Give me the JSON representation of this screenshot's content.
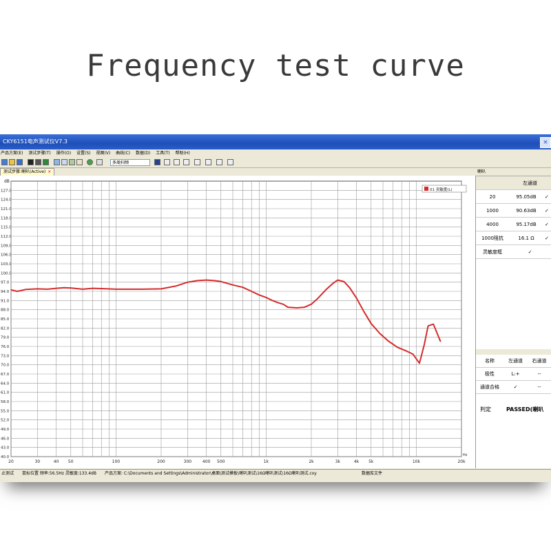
{
  "heading": "Frequency test curve",
  "window": {
    "title": "CKY6151电声测试仪V7.3",
    "close_icon": "close-icon"
  },
  "menu": [
    "产品方案(E)",
    "测试步骤(T)",
    "操作(O)",
    "设置(S)",
    "视图(V)",
    "曲线(C)",
    "数据(D)",
    "工具(T)",
    "帮助(H)"
  ],
  "toolbar": {
    "combo_value": "多周扫频"
  },
  "tab": {
    "label": "测试步骤:喇叭(Active)",
    "close": "×"
  },
  "right_panel": {
    "title": "喇叭",
    "column_header": "左通道",
    "rows": [
      {
        "name": "20",
        "value": "95.05dB",
        "status": "✓"
      },
      {
        "name": "1000",
        "value": "90.63dB",
        "status": "✓"
      },
      {
        "name": "4000",
        "value": "95.17dB",
        "status": "✓"
      },
      {
        "name": "1000阻抗",
        "value": "16.1 Ω",
        "status": "✓"
      },
      {
        "name": "灵敏度框",
        "value": "",
        "status": "✓"
      }
    ],
    "summary_headers": [
      "名称",
      "左通道",
      "右通道"
    ],
    "summary_rows": [
      [
        "极性",
        "L:+",
        "--"
      ],
      [
        "通道合格",
        "✓",
        "--"
      ]
    ],
    "verdict_label": "判定",
    "verdict_value": "PASSED(喇叭"
  },
  "status_bar": {
    "left": "止测试",
    "cursor": "鼠标位置 频率:56.5Hz 灵敏度:133.4dB",
    "scheme": "产品方案: C:\\Documents and Settings\\Administrator\\桌面\\测试模板\\喇叭测试\\16Ω喇叭测试\\16Ω喇叭测试.cxy",
    "db": "数据库文件"
  },
  "chart_data": {
    "type": "line",
    "x_scale": "log",
    "xlim": [
      20,
      20000
    ],
    "ylim": [
      40,
      130
    ],
    "ylabel": "dB",
    "xlabel_unit": "Hz",
    "y_ticks": [
      "127.0",
      "124.0",
      "121.0",
      "118.0",
      "115.0",
      "112.0",
      "109.0",
      "106.0",
      "103.0",
      "100.0",
      "97.0",
      "94.0",
      "91.0",
      "88.0",
      "85.0",
      "82.0",
      "79.0",
      "76.0",
      "73.0",
      "70.0",
      "67.0",
      "64.0",
      "61.0",
      "58.0",
      "55.0",
      "52.0",
      "49.0",
      "46.0",
      "43.0",
      "40.0"
    ],
    "x_ticks": [
      {
        "v": 20,
        "t": "20"
      },
      {
        "v": 30,
        "t": "30"
      },
      {
        "v": 40,
        "t": "40"
      },
      {
        "v": 50,
        "t": "50"
      },
      {
        "v": 100,
        "t": "100"
      },
      {
        "v": 200,
        "t": "200"
      },
      {
        "v": 300,
        "t": "300"
      },
      {
        "v": 400,
        "t": "400"
      },
      {
        "v": 500,
        "t": "500"
      },
      {
        "v": 1000,
        "t": "1k"
      },
      {
        "v": 2000,
        "t": "2k"
      },
      {
        "v": 3000,
        "t": "3k"
      },
      {
        "v": 4000,
        "t": "4k"
      },
      {
        "v": 5000,
        "t": "5k"
      },
      {
        "v": 10000,
        "t": "10k"
      },
      {
        "v": 20000,
        "t": "20k"
      }
    ],
    "grid": true,
    "legend_position": "top-right",
    "series": [
      {
        "name": "01 灵敏度(L)",
        "color": "#d42a2a",
        "points": [
          [
            20,
            94.5
          ],
          [
            22,
            94.0
          ],
          [
            25,
            94.6
          ],
          [
            30,
            94.8
          ],
          [
            35,
            94.7
          ],
          [
            40,
            95.0
          ],
          [
            45,
            95.2
          ],
          [
            50,
            95.1
          ],
          [
            60,
            94.7
          ],
          [
            70,
            95.0
          ],
          [
            80,
            94.9
          ],
          [
            100,
            94.7
          ],
          [
            150,
            94.7
          ],
          [
            200,
            94.8
          ],
          [
            250,
            95.7
          ],
          [
            300,
            97.0
          ],
          [
            350,
            97.5
          ],
          [
            400,
            97.7
          ],
          [
            450,
            97.5
          ],
          [
            500,
            97.2
          ],
          [
            600,
            96.1
          ],
          [
            700,
            95.3
          ],
          [
            800,
            94.0
          ],
          [
            900,
            92.8
          ],
          [
            1000,
            92.0
          ],
          [
            1100,
            91.0
          ],
          [
            1200,
            90.3
          ],
          [
            1300,
            89.8
          ],
          [
            1400,
            88.8
          ],
          [
            1600,
            88.6
          ],
          [
            1800,
            88.8
          ],
          [
            2000,
            89.8
          ],
          [
            2200,
            91.6
          ],
          [
            2500,
            94.5
          ],
          [
            2800,
            96.7
          ],
          [
            3000,
            97.7
          ],
          [
            3300,
            97.2
          ],
          [
            3600,
            95.2
          ],
          [
            4000,
            91.8
          ],
          [
            4500,
            87.2
          ],
          [
            5000,
            83.5
          ],
          [
            5700,
            80.3
          ],
          [
            6500,
            77.8
          ],
          [
            7500,
            75.7
          ],
          [
            8500,
            74.6
          ],
          [
            9500,
            73.5
          ],
          [
            10500,
            70.5
          ],
          [
            11300,
            76.5
          ],
          [
            12000,
            82.7
          ],
          [
            13000,
            83.3
          ],
          [
            14500,
            77.6
          ]
        ]
      }
    ]
  }
}
